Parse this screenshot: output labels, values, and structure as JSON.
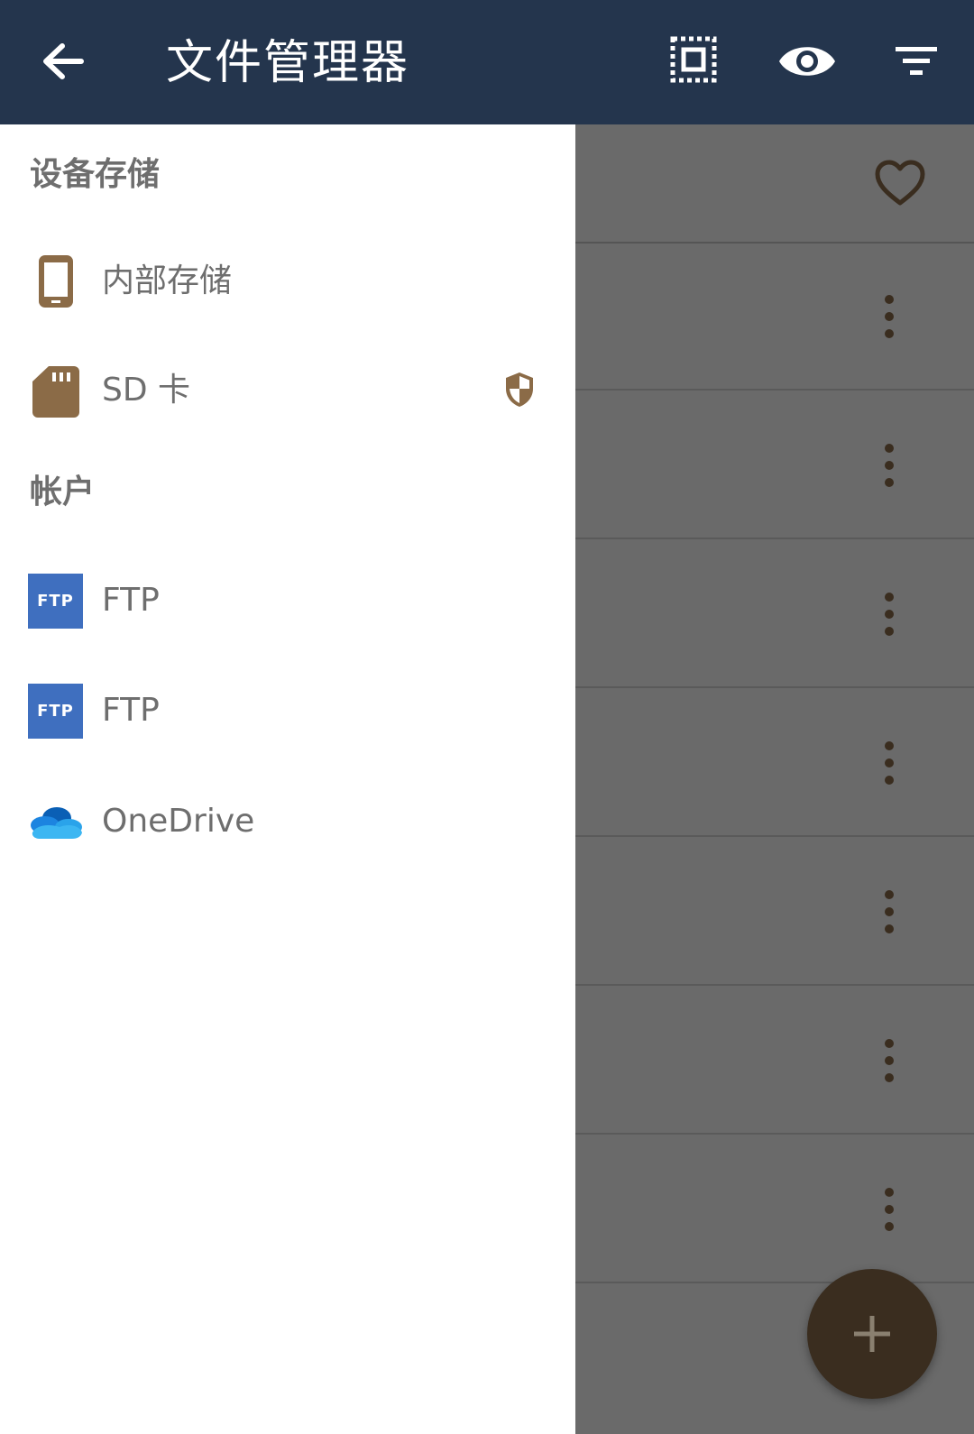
{
  "appbar": {
    "title": "文件管理器",
    "back_icon": "arrow-back-icon",
    "select_icon": "select-all-icon",
    "view_icon": "eye-icon",
    "filter_icon": "filter-icon"
  },
  "drawer": {
    "device_storage": {
      "title": "设备存储",
      "items": [
        {
          "label": "内部存储",
          "icon": "phone-icon"
        },
        {
          "label": "SD 卡",
          "icon": "sd-card-icon",
          "badge_icon": "shield-icon"
        }
      ]
    },
    "accounts": {
      "title": "帐户",
      "items": [
        {
          "label": "FTP",
          "icon": "ftp-icon",
          "icon_text": "FTP"
        },
        {
          "label": "FTP",
          "icon": "ftp-icon",
          "icon_text": "FTP"
        },
        {
          "label": "OneDrive",
          "icon": "onedrive-icon"
        }
      ]
    }
  },
  "background": {
    "favorite_icon": "heart-icon",
    "row_menu_icon": "more-vertical-icon",
    "fab_icon": "plus-icon"
  },
  "colors": {
    "appbar_bg": "#24354d",
    "accent_brown": "#8b6b47",
    "fab_bg": "#3a2d1f",
    "scrim": "#6a6a6a",
    "ftp_blue": "#3f6fbf"
  }
}
